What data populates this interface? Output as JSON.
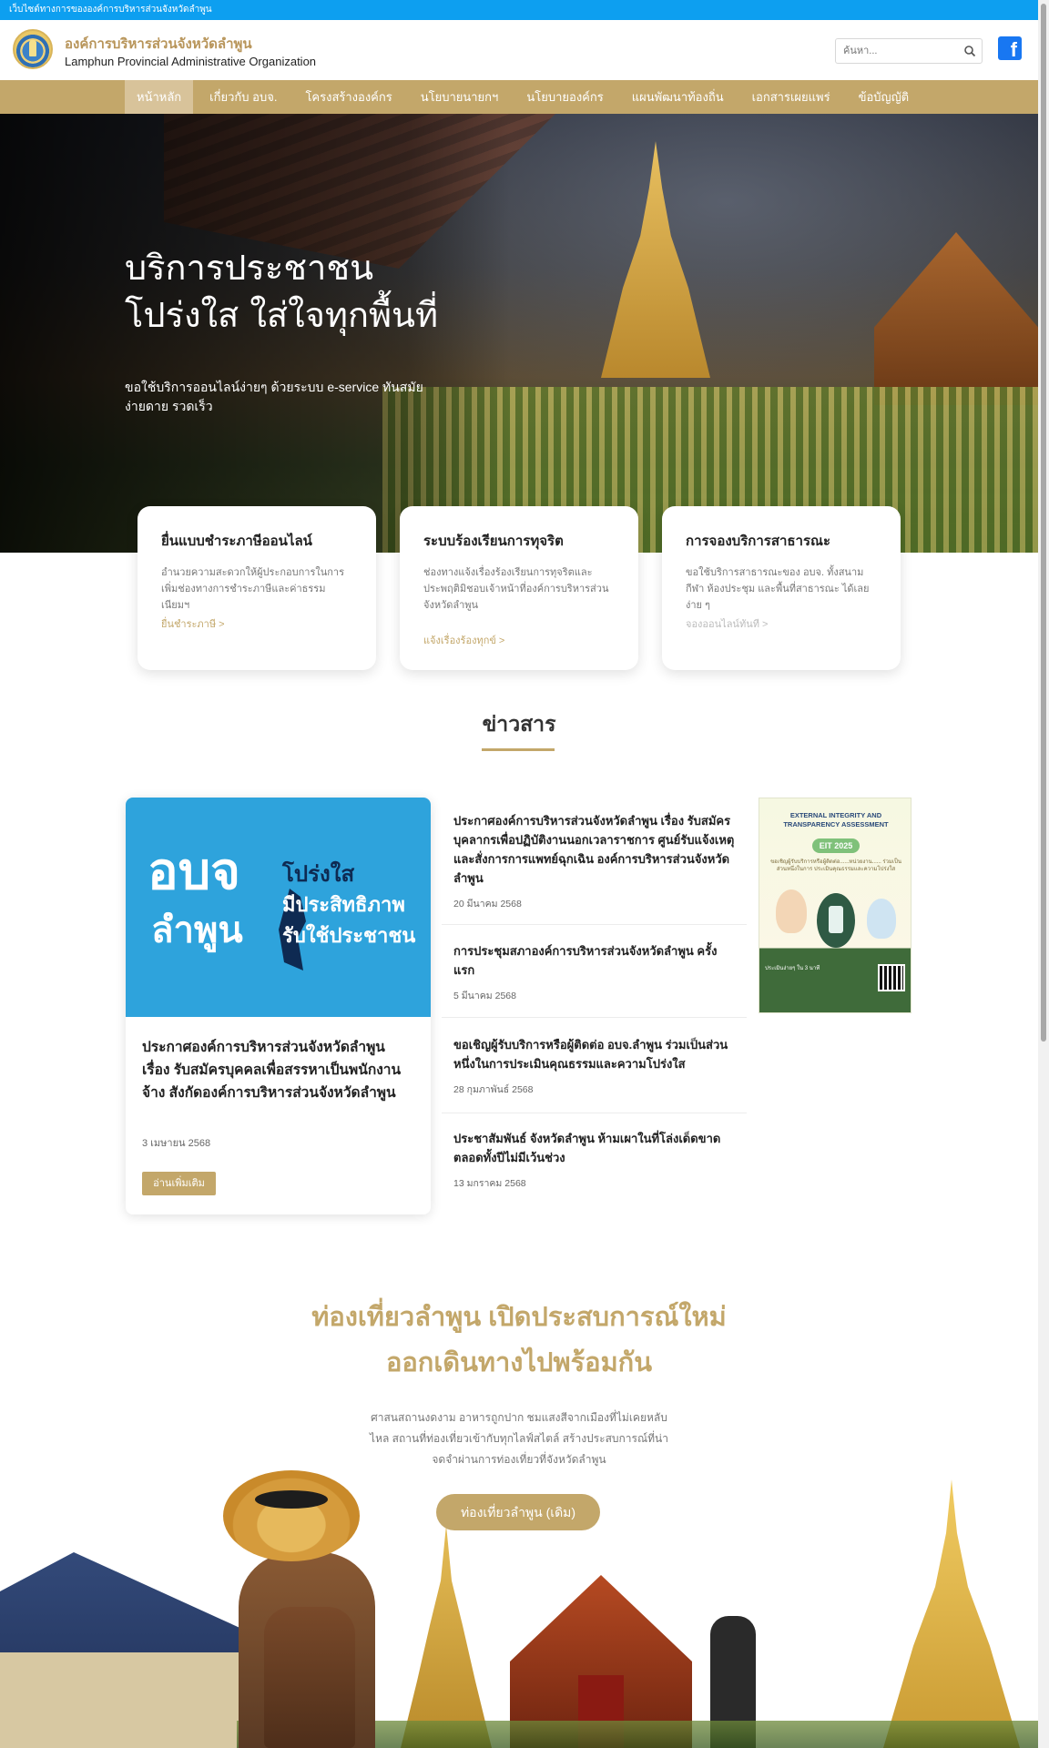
{
  "top_strip": {
    "text": "เว็บไซต์ทางการขององค์การบริหารส่วนจังหวัดลำพูน"
  },
  "header": {
    "org_name_th": "องค์การบริหารส่วนจังหวัดลำพูน",
    "org_name_en": "Lamphun Provincial Administrative Organization",
    "search_placeholder": "ค้นหา...",
    "facebook_glyph": "f"
  },
  "nav": {
    "items": [
      {
        "label": "หน้าหลัก",
        "active": true
      },
      {
        "label": "เกี่ยวกับ อบจ."
      },
      {
        "label": "โครงสร้างองค์กร"
      },
      {
        "label": "นโยบายนายกฯ"
      },
      {
        "label": "นโยบายองค์กร"
      },
      {
        "label": "แผนพัฒนาท้องถิ่น"
      },
      {
        "label": "เอกสารเผยแพร่"
      },
      {
        "label": "ข้อบัญญัติ"
      }
    ]
  },
  "hero": {
    "title_line1": "บริการประชาชน",
    "title_line2": "โปร่งใส ใส่ใจทุกพื้นที่",
    "subtitle": "ขอใช้บริการออนไลน์ง่ายๆ ด้วยระบบ e-service ทันสมัย ง่ายดาย รวดเร็ว"
  },
  "services": [
    {
      "title": "ยื่นแบบชำระภาษีออนไลน์",
      "desc": "อำนวยความสะดวกให้ผู้ประกอบการในการเพิ่มช่องทางการชำระภาษีและค่าธรรมเนียมฯ",
      "link": "ยื่นชำระภาษี >"
    },
    {
      "title": "ระบบร้องเรียนการทุจริต",
      "desc": "ช่องทางแจ้งเรื่องร้องเรียนการทุจริตและประพฤติมิชอบเจ้าหน้าที่องค์การบริหารส่วนจังหวัดลำพูน",
      "link": "แจ้งเรื่องร้องทุกข์ >"
    },
    {
      "title": "การจองบริการสาธารณะ",
      "desc": "ขอใช้บริการสาธารณะของ อบจ. ทั้งสนามกีฬา ห้องประชุม และพื้นที่สาธารณะ ได้เลยง่าย ๆ",
      "link": "จองออนไลน์ทันที >"
    }
  ],
  "news": {
    "heading": "ข่าวสาร",
    "featured": {
      "banner_big": "อบจ",
      "banner_sub": "ลำพูน",
      "banner_slogan1": "โปร่งใส",
      "banner_slogan2": "มีประสิทธิภาพ",
      "banner_slogan3": "รับใช้ประชาชน",
      "title": "ประกาศองค์การบริหารส่วนจังหวัดลำพูน เรื่อง รับสมัครบุคคลเพื่อสรรหาเป็นพนักงานจ้าง สังกัดองค์การบริหารส่วนจังหวัดลำพูน",
      "date": "3 เมษายน 2568",
      "button": "อ่านเพิ่มเติม"
    },
    "items": [
      {
        "title": "ประกาศองค์การบริหารส่วนจังหวัดลำพูน เรื่อง รับสมัครบุคลากรเพื่อปฏิบัติงานนอกเวลาราชการ ศูนย์รับแจ้งเหตุและสั่งการการแพทย์ฉุกเฉิน องค์การบริหารส่วนจังหวัดลำพูน",
        "date": "20 มีนาคม 2568"
      },
      {
        "title": "การประชุมสภาองค์การบริหารส่วนจังหวัดลำพูน ครั้งแรก",
        "date": "5 มีนาคม 2568"
      },
      {
        "title": "ขอเชิญผู้รับบริการหรือผู้ติดต่อ อบจ.ลำพูน ร่วมเป็นส่วนหนึ่งในการประเมินคุณธรรมและความโปร่งใส",
        "date": "28 กุมภาพันธ์ 2568"
      },
      {
        "title": "ประชาสัมพันธ์ จังหวัดลำพูน ห้ามเผาในที่โล่งเด็ดขาด ตลอดทั้งปีไม่มีเว้นช่วง",
        "date": "13 มกราคม 2568"
      }
    ],
    "poster": {
      "title": "EXTERNAL INTEGRITY AND TRANSPARENCY ASSESSMENT",
      "badge": "EIT 2025",
      "note": "ขอเชิญผู้รับบริการหรือผู้ติดต่อ......หน่วยงาน...... ร่วมเป็นส่วนหนึ่งในการ ประเมินคุณธรรมและความโปร่งใส",
      "footer": "ประเมินง่ายๆ ใน 3 นาที"
    }
  },
  "tourism": {
    "heading_line1": "ท่องเที่ยวลำพูน เปิดประสบการณ์ใหม่",
    "heading_line2": "ออกเดินทางไปพร้อมกัน",
    "desc": "ศาสนสถานงดงาม อาหารถูกปาก ชมแสงสีจากเมืองที่ไม่เคยหลับไหล สถานที่ท่องเที่ยวเข้ากับทุกไลฟ์สไตล์ สร้างประสบการณ์ที่น่าจดจำผ่านการท่องเที่ยวที่จังหวัดลำพูน",
    "button": "ท่องเที่ยวลำพูน (เดิม)"
  },
  "colors": {
    "gold": "#c3a76a",
    "top_strip": "#0d9ff0",
    "facebook": "#1877f2",
    "banner_blue": "#2ea3dc"
  }
}
